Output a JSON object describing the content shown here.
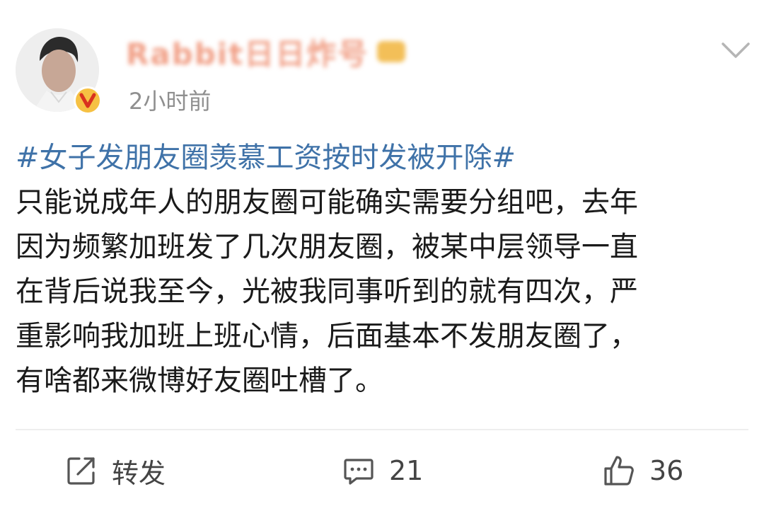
{
  "post": {
    "author": {
      "name": "Rabbit日日炸号",
      "avatar_icon": "person-avatar",
      "verified_badge_icon": "verified-v-icon",
      "member_icon": "vip-crown-icon"
    },
    "timestamp": "2小时前",
    "menu_icon": "chevron-down-icon",
    "topic": "#女子发朋友圈羡慕工资按时发被开除#",
    "body_lines": [
      "只能说成年人的朋友圈可能确实需要分组吧，去年",
      "因为频繁加班发了几次朋友圈，被某中层领导一直",
      "在背后说我至今，光被我同事听到的就有四次，严",
      "重影响我加班上班心情，后面基本不发朋友圈了，",
      "有啥都来微博好友圈吐槽了。"
    ]
  },
  "actions": {
    "repost": {
      "icon": "share-icon",
      "label": "转发"
    },
    "comment": {
      "icon": "comment-icon",
      "count": "21"
    },
    "like": {
      "icon": "thumbs-up-icon",
      "count": "36"
    }
  },
  "colors": {
    "topic_link": "#3f72a8",
    "timestamp": "#8f8f8f",
    "username_blurred": "#f1a087",
    "badge": "#f6c143",
    "badge_v": "#d9321f"
  }
}
